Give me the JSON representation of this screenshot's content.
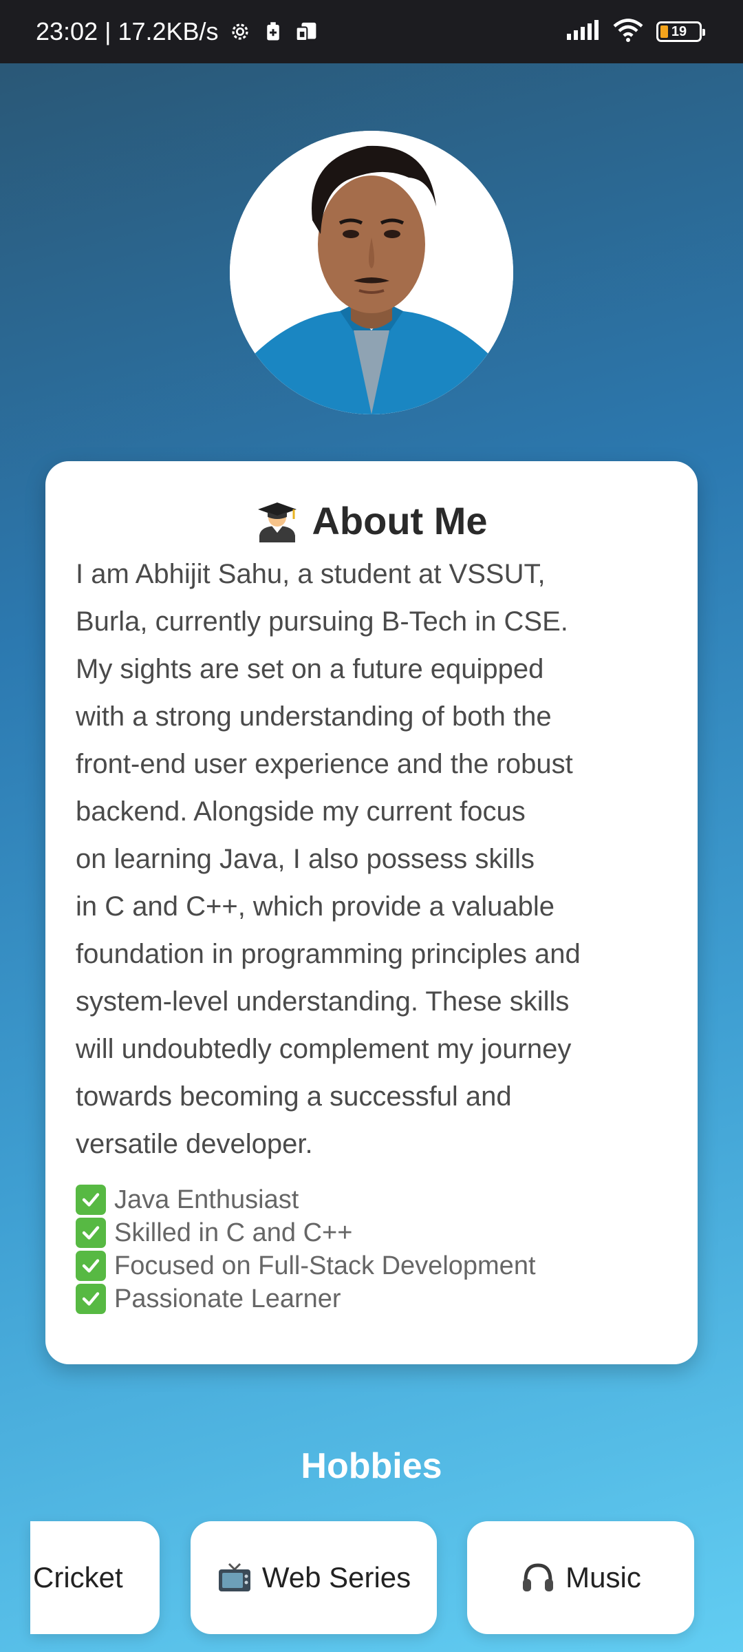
{
  "status_bar": {
    "time_speed": "23:02 | 17.2KB/s",
    "battery_level": "19"
  },
  "profile": {
    "avatar_alt": "Profile photo"
  },
  "about": {
    "title": "About Me",
    "title_icon": "graduate-emoji",
    "paragraph": "I am Abhijit Sahu, a student at VSSUT,\nBurla, currently pursuing B-Tech in CSE.\nMy sights are set on a future equipped\nwith a strong understanding of both the\nfront-end user experience and the robust\nbackend. Alongside my current focus\non learning Java, I also possess skills\nin C and C++, which provide a valuable\nfoundation in programming principles and\nsystem-level understanding. These skills\nwill undoubtedly complement my journey\ntowards becoming a successful and\nversatile developer.",
    "skills": [
      "Java Enthusiast",
      "Skilled in C and C++",
      "Focused on Full-Stack Development",
      "Passionate Learner"
    ]
  },
  "hobbies": {
    "title": "Hobbies",
    "items": [
      {
        "label": "Cricket",
        "icon": ""
      },
      {
        "label": "Web Series",
        "icon": "tv-icon"
      },
      {
        "label": "Music",
        "icon": "headphones-icon"
      }
    ]
  },
  "colors": {
    "status_bar_bg": "#1c1c20",
    "check_green": "#57b943",
    "bg_top": "#2a5470",
    "bg_bottom": "#62cdf2"
  }
}
